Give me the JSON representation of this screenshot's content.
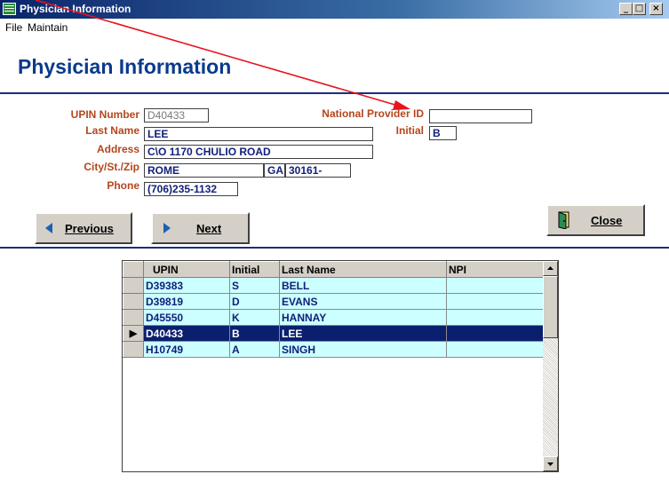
{
  "window": {
    "title": "Physician Information",
    "min_glyph": "_",
    "max_glyph": "□",
    "close_glyph": "×"
  },
  "menu": {
    "items": [
      "File",
      "Maintain"
    ]
  },
  "page_title": "Physician Information",
  "form": {
    "upin_label": "UPIN Number",
    "upin_value": "D40433",
    "npi_label": "National Provider ID",
    "npi_value": "",
    "lastname_label": "Last Name",
    "lastname_value": "LEE",
    "initial_label": "Initial",
    "initial_value": "B",
    "address_label": "Address",
    "address_value": "C\\O 1170 CHULIO ROAD",
    "city_label": "City/St./Zip",
    "city_value": "ROME",
    "state_value": "GA",
    "zip_value": "30161-",
    "phone_label": "Phone",
    "phone_value": "(706)235-1132"
  },
  "buttons": {
    "previous": "Previous",
    "next": "Next",
    "close": "Close"
  },
  "grid": {
    "columns": [
      "UPIN",
      "Initial",
      "Last Name",
      "NPI"
    ],
    "rows": [
      {
        "upin": "D39383",
        "initial": "S",
        "last": "BELL",
        "npi": ""
      },
      {
        "upin": "D39819",
        "initial": "D",
        "last": "EVANS",
        "npi": ""
      },
      {
        "upin": "D45550",
        "initial": "K",
        "last": "HANNAY",
        "npi": ""
      },
      {
        "upin": "D40433",
        "initial": "B",
        "last": "LEE",
        "npi": ""
      },
      {
        "upin": "H10749",
        "initial": "A",
        "last": "SINGH",
        "npi": ""
      }
    ],
    "selected_row_index": 3,
    "row_pointer": "▶"
  },
  "colors": {
    "label": "#b4461c",
    "value": "#10207a",
    "title": "#0a3a8c",
    "annotation_arrow": "#e8141e"
  }
}
